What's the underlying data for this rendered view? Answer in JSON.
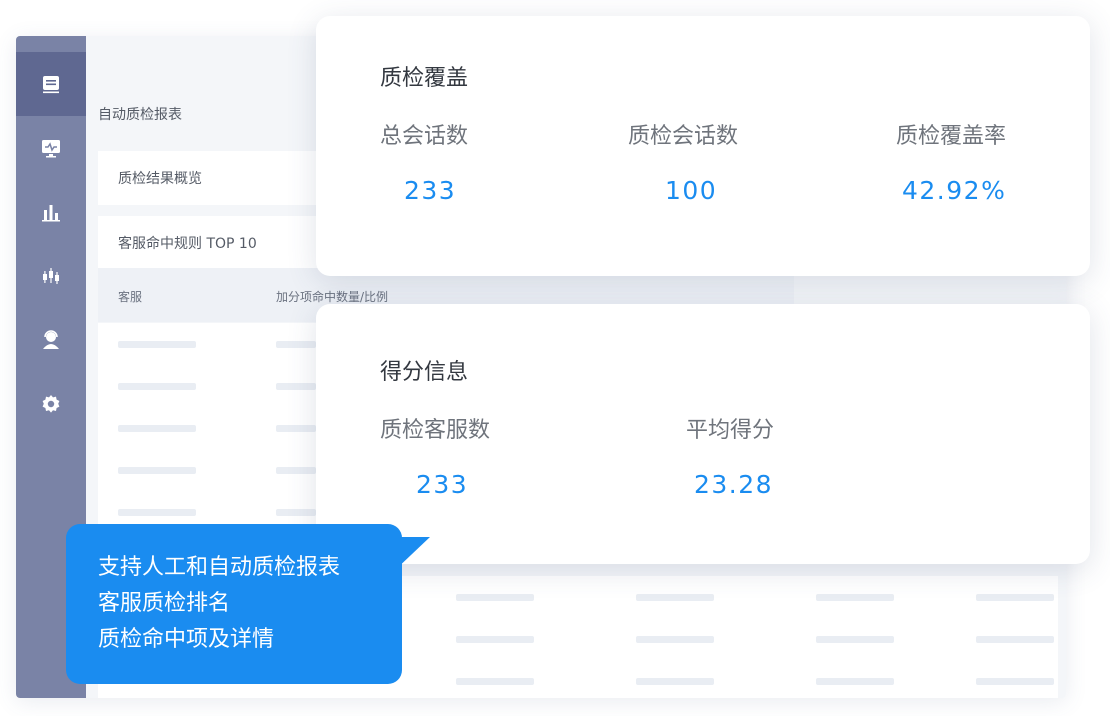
{
  "background": {
    "page_heading": "自动质检报表",
    "section_overview": "质检结果概览",
    "section_ranking": "客服命中规则 TOP 10",
    "table_headers": [
      "客服",
      "加分项命中数量/比例"
    ]
  },
  "coverage_card": {
    "title": "质检覆盖",
    "metrics": [
      {
        "label": "总会话数",
        "value": "233"
      },
      {
        "label": "质检会话数",
        "value": "100"
      },
      {
        "label": "质检覆盖率",
        "value": "42.92%"
      }
    ]
  },
  "score_card": {
    "title": "得分信息",
    "metrics": [
      {
        "label": "质检客服数",
        "value": "233"
      },
      {
        "label": "平均得分",
        "value": "23.28"
      }
    ]
  },
  "callout": {
    "lines": [
      "支持人工和自动质检报表",
      "客服质检排名",
      "质检命中项及详情"
    ]
  },
  "colors": {
    "accent": "#1a8cf0",
    "sidebar": "#7a83a6",
    "sidebar_active": "#5f6891"
  },
  "sidebar_icons": [
    "report-icon",
    "monitor-icon",
    "bar-chart-icon",
    "candlestick-icon",
    "agent-icon",
    "gear-icon"
  ]
}
